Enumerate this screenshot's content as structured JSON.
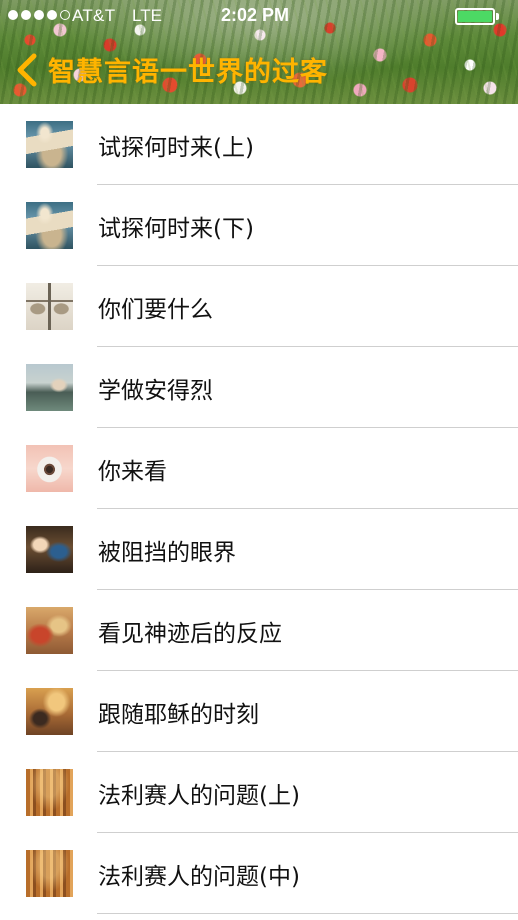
{
  "status_bar": {
    "carrier": "AT&T",
    "network": "LTE",
    "time": "2:02 PM",
    "signal_bars_filled": 4,
    "signal_bars_total": 5,
    "battery_level": 1.0,
    "battery_color": "#4cd964"
  },
  "nav": {
    "back_icon": "chevron-left-icon",
    "title": "智慧言语一世界的过客",
    "title_color": "#ffb400"
  },
  "list": {
    "items": [
      {
        "label": "试探何时来(上)",
        "thumbnail": "statue"
      },
      {
        "label": "试探何时来(下)",
        "thumbnail": "statue"
      },
      {
        "label": "你们要什么",
        "thumbnail": "scales"
      },
      {
        "label": "学做安得烈",
        "thumbnail": "street"
      },
      {
        "label": "你来看",
        "thumbnail": "eye"
      },
      {
        "label": "被阻挡的眼界",
        "thumbnail": "couple"
      },
      {
        "label": "看见神迹后的反应",
        "thumbnail": "painting"
      },
      {
        "label": "跟随耶稣的时刻",
        "thumbnail": "painting"
      },
      {
        "label": "法利赛人的问题(上)",
        "thumbnail": "pharisee"
      },
      {
        "label": "法利赛人的问题(中)",
        "thumbnail": "pharisee"
      }
    ]
  }
}
